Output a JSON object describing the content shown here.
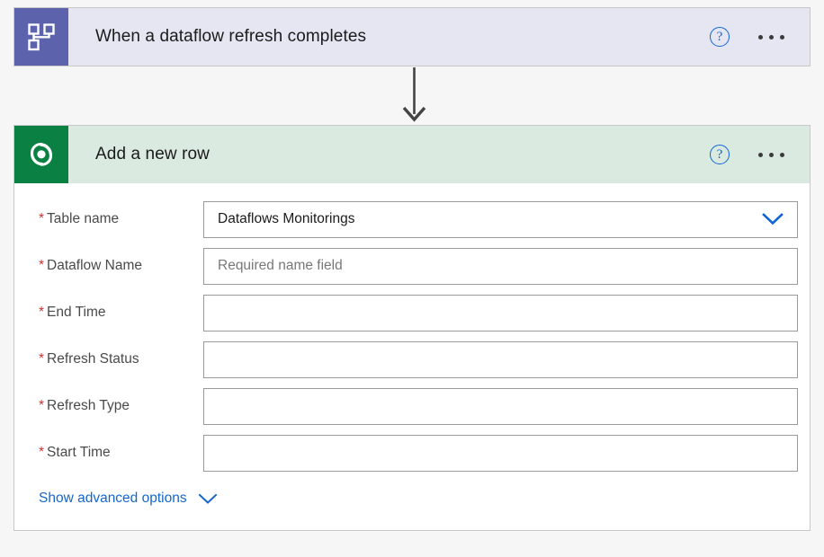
{
  "flow": {
    "trigger_card": {
      "title": "When a dataflow refresh completes",
      "icon": "dataflow-hierarchy-icon",
      "icon_color": "#5c62ac",
      "header_color": "#e6e6f3",
      "help_label": "?",
      "more_label": "..."
    },
    "connector": {
      "icon": "arrow-down-icon",
      "color": "#444444"
    },
    "action_card": {
      "title": "Add a new row",
      "icon": "dataverse-swirl-icon",
      "icon_color": "#0b8043",
      "header_color": "#daeae0",
      "help_label": "?",
      "more_label": "...",
      "fields": [
        {
          "label": "Table name",
          "required": true,
          "type": "select",
          "value": "Dataflows Monitorings",
          "placeholder": "",
          "chevron": "chevron-down-icon"
        },
        {
          "label": "Dataflow Name",
          "required": true,
          "type": "text",
          "value": "",
          "placeholder": "Required name field"
        },
        {
          "label": "End Time",
          "required": true,
          "type": "text",
          "value": "",
          "placeholder": ""
        },
        {
          "label": "Refresh Status",
          "required": true,
          "type": "text",
          "value": "",
          "placeholder": ""
        },
        {
          "label": "Refresh Type",
          "required": true,
          "type": "text",
          "value": "",
          "placeholder": ""
        },
        {
          "label": "Start Time",
          "required": true,
          "type": "text",
          "value": "",
          "placeholder": ""
        }
      ],
      "advanced": {
        "label": "Show advanced options",
        "icon": "chevron-down-icon",
        "color": "#1667c9"
      }
    }
  },
  "colors": {
    "canvas": "#f6f6f6",
    "card_border": "#c8c8c8",
    "required_star": "#d13438",
    "link_blue": "#1667c9",
    "help_blue": "#1164d8",
    "field_border": "#9a9a9a",
    "label_text": "#4a4a4a",
    "placeholder_text": "#787878"
  }
}
